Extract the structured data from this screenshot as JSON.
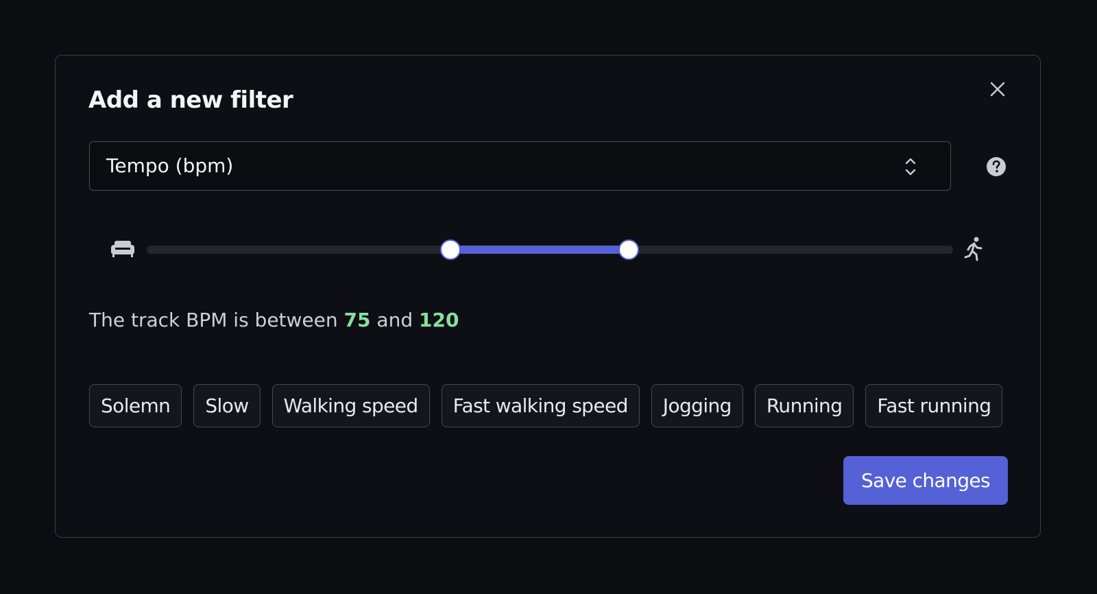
{
  "dialog": {
    "title": "Add a new filter",
    "close_icon": "close-icon"
  },
  "select": {
    "value": "Tempo (bpm)",
    "chevron_icon": "chevron-up-down-icon"
  },
  "help_icon": "question-circle-icon",
  "slider": {
    "min_icon": "couch-icon",
    "max_icon": "running-person-icon",
    "range_start_fraction": 0.377,
    "range_end_fraction": 0.598,
    "accent_color": "#5561d6"
  },
  "summary": {
    "prefix": "The track BPM is between",
    "low": "75",
    "middle": "and",
    "high": "120",
    "number_color": "#86e0a0"
  },
  "presets": [
    {
      "label": "Solemn"
    },
    {
      "label": "Slow"
    },
    {
      "label": "Walking speed"
    },
    {
      "label": "Fast walking speed"
    },
    {
      "label": "Jogging"
    },
    {
      "label": "Running"
    },
    {
      "label": "Fast running"
    }
  ],
  "actions": {
    "save_label": "Save changes"
  }
}
